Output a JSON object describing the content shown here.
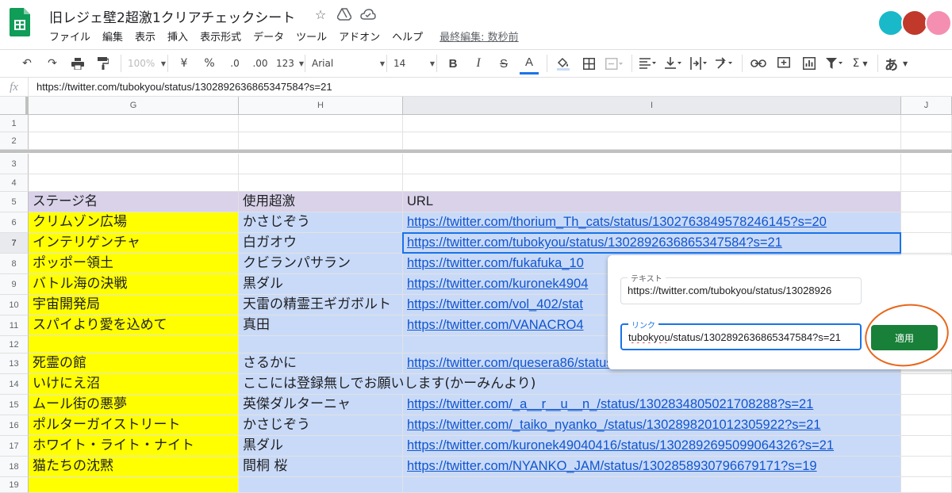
{
  "app": {
    "title": "旧レジェ壁2超激1クリアチェックシート",
    "menu": [
      "ファイル",
      "編集",
      "表示",
      "挿入",
      "表示形式",
      "データ",
      "ツール",
      "アドオン",
      "ヘルプ"
    ],
    "last_edit": "最終編集: 数秒前",
    "title_icons": [
      "star-icon",
      "drive-move-icon",
      "cloud-saved-icon"
    ]
  },
  "toolbar": {
    "zoom": "100%",
    "currency": "¥",
    "percent": "%",
    "dec_decrease": ".0",
    "dec_increase": ".00",
    "number_format": "123",
    "font": "Arial",
    "font_size": "14",
    "bold": "B",
    "italic": "I",
    "strike": "S",
    "text_color": "A",
    "input_tools": "あ",
    "function": "Σ"
  },
  "formula_bar": {
    "fx": "fx",
    "value": "https://twitter.com/tubokyou/status/1302892636865347584?s=21"
  },
  "columns": [
    "G",
    "H",
    "I",
    "J"
  ],
  "rows": [
    {
      "num": "1",
      "g": "",
      "h": "",
      "i": "",
      "g_bg": "white",
      "h_bg": "white",
      "i_bg": "white"
    },
    {
      "num": "2",
      "g": "",
      "h": "",
      "i": "",
      "g_bg": "white",
      "h_bg": "white",
      "i_bg": "white"
    },
    {
      "num": "3",
      "g": "",
      "h": "",
      "i": "",
      "g_bg": "white",
      "h_bg": "white",
      "i_bg": "white"
    },
    {
      "num": "4",
      "g": "",
      "h": "",
      "i": "",
      "g_bg": "white",
      "h_bg": "white",
      "i_bg": "white"
    },
    {
      "num": "5",
      "g": "ステージ名",
      "h": "使用超激",
      "i": "URL",
      "g_bg": "purple",
      "h_bg": "purple",
      "i_bg": "purple",
      "header": true
    },
    {
      "num": "6",
      "g": "クリムゾン広場",
      "h": "かさじぞう",
      "i": "https://twitter.com/thorium_Th_cats/status/1302763849578246145?s=20",
      "g_bg": "yellow",
      "h_bg": "blue",
      "i_bg": "blue"
    },
    {
      "num": "7",
      "g": "インテリゲンチャ",
      "h": "白ガオウ",
      "i": "https://twitter.com/tubokyou/status/1302892636865347584?s=21",
      "g_bg": "yellow",
      "h_bg": "blue",
      "i_bg": "blue"
    },
    {
      "num": "8",
      "g": "ポッポー領土",
      "h": "クビランパサラン",
      "i": "https://twitter.com/fukafuka_10",
      "g_bg": "yellow",
      "h_bg": "blue",
      "i_bg": "blue"
    },
    {
      "num": "9",
      "g": "バトル海の決戦",
      "h": "黒ダル",
      "i": "https://twitter.com/kuronek4904",
      "g_bg": "yellow",
      "h_bg": "blue",
      "i_bg": "blue"
    },
    {
      "num": "10",
      "g": "宇宙開発局",
      "h": "天雷の精霊王ギガボルト",
      "i": "https://twitter.com/vol_402/stat",
      "g_bg": "yellow",
      "h_bg": "blue",
      "i_bg": "blue"
    },
    {
      "num": "11",
      "g": "スパイより愛を込めて",
      "h": "真田",
      "i": "https://twitter.com/VANACRO4",
      "g_bg": "yellow",
      "h_bg": "blue",
      "i_bg": "blue"
    },
    {
      "num": "12",
      "g": "",
      "h": "",
      "i": "",
      "g_bg": "yellow",
      "h_bg": "blue",
      "i_bg": "blue"
    },
    {
      "num": "13",
      "g": "死霊の館",
      "h": "さるかに",
      "i": "https://twitter.com/quesera86/status/1302890777910492016?s=21",
      "g_bg": "yellow",
      "h_bg": "blue",
      "i_bg": "blue"
    },
    {
      "num": "14",
      "g": "いけにえ沼",
      "h": "ここには登録無しでお願いします(かーみんより)",
      "i": "",
      "g_bg": "yellow",
      "h_bg": "blue",
      "i_bg": "blue",
      "h_overflow": true
    },
    {
      "num": "15",
      "g": "ムール街の悪夢",
      "h": "英傑ダルターニャ",
      "i": "https://twitter.com/_a__r__u__n_/status/1302834805021708288?s=21",
      "g_bg": "yellow",
      "h_bg": "blue",
      "i_bg": "blue"
    },
    {
      "num": "16",
      "g": "ポルターガイストリート",
      "h": "かさじぞう",
      "i": "https://twitter.com/_taiko_nyanko_/status/1302898201012305922?s=21",
      "g_bg": "yellow",
      "h_bg": "blue",
      "i_bg": "blue"
    },
    {
      "num": "17",
      "g": "ホワイト・ライト・ナイト",
      "h": "黒ダル",
      "i": "https://twitter.com/kuronek49040416/status/1302892695099064326?s=21",
      "g_bg": "yellow",
      "h_bg": "blue",
      "i_bg": "blue"
    },
    {
      "num": "18",
      "g": "猫たちの沈黙",
      "h": "間桐 桜",
      "i": "https://twitter.com/NYANKO_JAM/status/1302858930796679171?s=19",
      "g_bg": "yellow",
      "h_bg": "blue",
      "i_bg": "blue"
    },
    {
      "num": "19",
      "g": "",
      "h": "",
      "i": "",
      "g_bg": "yellow",
      "h_bg": "blue",
      "i_bg": "blue"
    }
  ],
  "link_popup": {
    "text_label": "テキスト",
    "text_value": "https://twitter.com/tubokyou/status/13028926",
    "link_label": "リンク",
    "link_value_underlined": "tubokyou",
    "link_value_rest": "/status/1302892636865347584?s=21",
    "apply_label": "適用"
  },
  "colors": {
    "yellow": "#ffff00",
    "blue": "#c9daf8",
    "purple": "#d9d2e9",
    "link": "#1155cc",
    "apply": "#188038",
    "annotation": "#e8671c"
  }
}
